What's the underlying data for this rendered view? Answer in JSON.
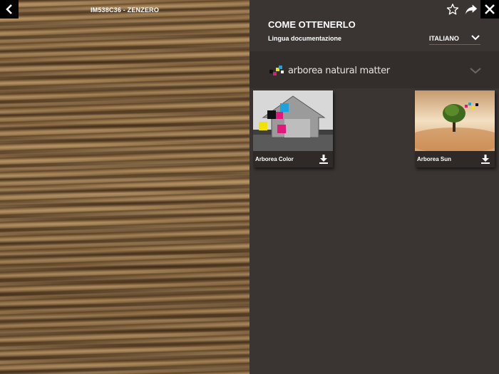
{
  "viewer": {
    "product_code": "IM538C36 - ZENZERO"
  },
  "panel": {
    "title": "COME OTTENERLO",
    "language_label": "Lingua documentazione",
    "language_value": "ITALIANO",
    "brand": {
      "name": "arborea natural matter"
    }
  },
  "documents": [
    {
      "label": "Arborea Color"
    },
    {
      "label": "Arborea Sun"
    }
  ],
  "icons": {
    "back": "chevron-left-icon",
    "favorite": "star-icon",
    "share": "share-icon",
    "close": "close-icon",
    "download": "download-icon"
  }
}
